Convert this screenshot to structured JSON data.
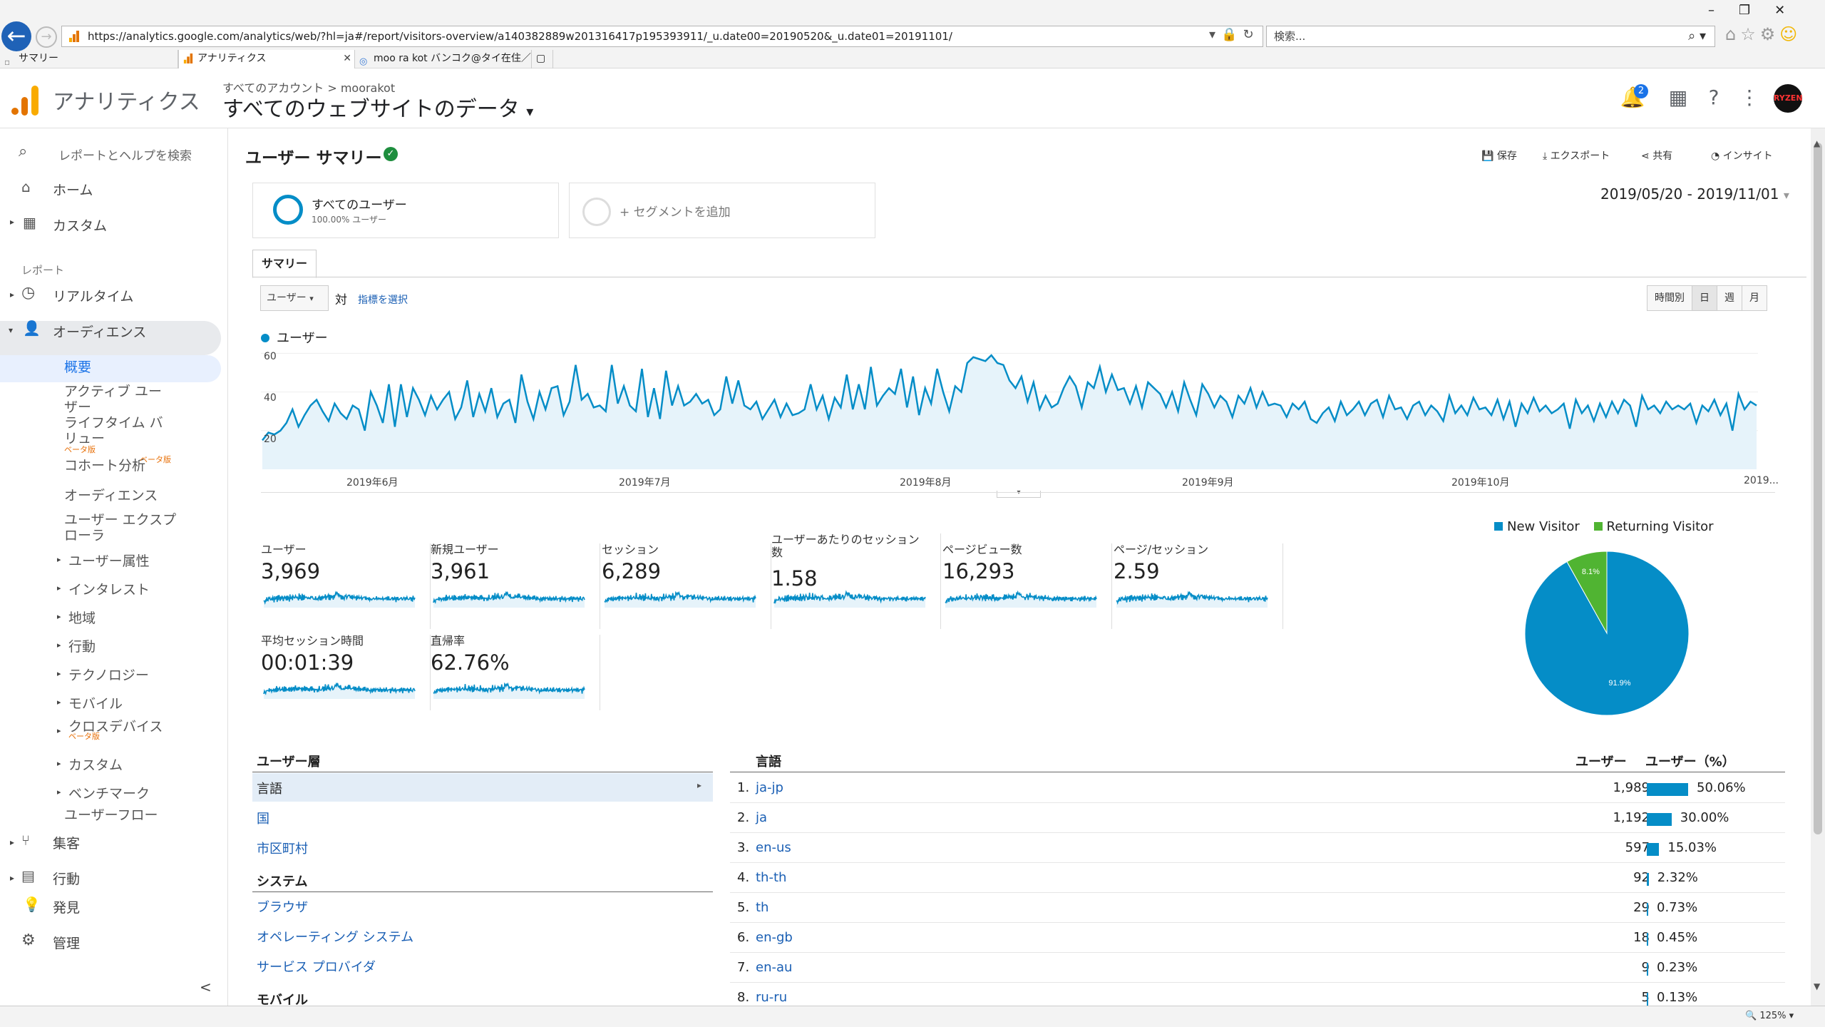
{
  "browser": {
    "url": "https://analytics.google.com/analytics/web/?hl=ja#/report/visitors-overview/a140382889w201316417p195393911/_u.date00=20190520&_u.date01=20191101/",
    "search_placeholder": "検索...",
    "tabs": [
      {
        "label": "サマリー"
      },
      {
        "label": "アナリティクス"
      },
      {
        "label": "moo ra kot バンコク@タイ在住／..."
      }
    ],
    "zoom": "125%"
  },
  "ga": {
    "product": "アナリティクス",
    "account_crumb": "すべてのアカウント > moorakot",
    "view_title": "すべてのウェブサイトのデータ",
    "notifications": "2",
    "avatar_text": "RYZEN"
  },
  "sidebar": {
    "search": "レポートとヘルプを検索",
    "home": "ホーム",
    "custom": "カスタム",
    "reports_header": "レポート",
    "realtime": "リアルタイム",
    "audience": "オーディエンス",
    "overview": "概要",
    "active_users": "アクティブ ユーザー",
    "lifetime_value": "ライフタイム バリュー",
    "cohort": "コホート分析",
    "beta": "ベータ版",
    "audiences": "オーディエンス",
    "user_explorer": "ユーザー エクスプローラ",
    "demographics": "ユーザー属性",
    "interests": "インタレスト",
    "geo": "地域",
    "behavior_sub": "行動",
    "technology": "テクノロジー",
    "mobile": "モバイル",
    "cross_device": "クロスデバイス",
    "custom_sub": "カスタム",
    "benchmarking": "ベンチマーク",
    "users_flow": "ユーザーフロー",
    "acquisition": "集客",
    "behavior": "行動",
    "discover": "発見",
    "admin": "管理",
    "collapse": "<"
  },
  "report": {
    "title": "ユーザー サマリー",
    "actions": {
      "save": "保存",
      "export": "エクスポート",
      "share": "共有",
      "insights": "インサイト"
    },
    "segment_name": "すべてのユーザー",
    "segment_sub": "100.00% ユーザー",
    "add_segment": "+ セグメントを追加",
    "date_range": "2019/05/20 - 2019/11/01",
    "tab_summary": "サマリー",
    "metric_select": "ユーザー",
    "vs": "対",
    "pick_metric": "指標を選択",
    "granularity": [
      "時間別",
      "日",
      "週",
      "月"
    ]
  },
  "chart_data": {
    "type": "area",
    "series": [
      {
        "name": "ユーザー",
        "color": "#058dc7"
      }
    ],
    "yticks": [
      "20",
      "40",
      "60"
    ],
    "ylim": [
      0,
      62
    ],
    "xticks": [
      "2019年6月",
      "2019年7月",
      "2019年8月",
      "2019年9月",
      "2019年10月",
      "2019..."
    ],
    "values": [
      15,
      19,
      18,
      20,
      24,
      31,
      22,
      28,
      33,
      36,
      30,
      25,
      34,
      29,
      26,
      33,
      31,
      20,
      40,
      33,
      24,
      44,
      22,
      44,
      27,
      42,
      36,
      28,
      38,
      31,
      36,
      40,
      26,
      32,
      46,
      27,
      39,
      30,
      42,
      27,
      34,
      36,
      24,
      49,
      35,
      26,
      40,
      31,
      42,
      43,
      28,
      35,
      54,
      36,
      39,
      32,
      33,
      30,
      54,
      34,
      43,
      33,
      30,
      52,
      27,
      42,
      26,
      51,
      33,
      43,
      33,
      35,
      39,
      34,
      36,
      28,
      31,
      48,
      34,
      46,
      33,
      31,
      35,
      26,
      31,
      36,
      27,
      34,
      28,
      29,
      31,
      44,
      31,
      38,
      26,
      37,
      32,
      49,
      31,
      44,
      31,
      53,
      33,
      38,
      42,
      39,
      52,
      32,
      48,
      28,
      42,
      34,
      52,
      40,
      30,
      43,
      40,
      55,
      58,
      57,
      56,
      59,
      55,
      54,
      46,
      42,
      48,
      35,
      45,
      31,
      38,
      32,
      34,
      42,
      48,
      43,
      32,
      45,
      42,
      53,
      40,
      49,
      41,
      42,
      34,
      43,
      32,
      45,
      42,
      39,
      32,
      40,
      30,
      45,
      36,
      28,
      44,
      39,
      32,
      38,
      35,
      27,
      38,
      34,
      42,
      32,
      40,
      33,
      34,
      33,
      27,
      34,
      31,
      35,
      26,
      24,
      29,
      32,
      25,
      35,
      28,
      31,
      35,
      28,
      34,
      36,
      27,
      38,
      31,
      32,
      26,
      33,
      35,
      28,
      33,
      30,
      25,
      38,
      29,
      33,
      28,
      37,
      31,
      32,
      28,
      36,
      26,
      35,
      22,
      34,
      29,
      37,
      30,
      33,
      29,
      31,
      34,
      21,
      36,
      29,
      33,
      25,
      34,
      27,
      35,
      29,
      36,
      33,
      22,
      38,
      31,
      33,
      29,
      35,
      31,
      33,
      31,
      34,
      24,
      33,
      30,
      36,
      28,
      34,
      20,
      39,
      31,
      35,
      33
    ]
  },
  "scorecards": [
    {
      "label": "ユーザー",
      "value": "3,969"
    },
    {
      "label": "新規ユーザー",
      "value": "3,961"
    },
    {
      "label": "セッション",
      "value": "6,289"
    },
    {
      "label": "ユーザーあたりのセッション数",
      "value": "1.58"
    },
    {
      "label": "ページビュー数",
      "value": "16,293"
    },
    {
      "label": "ページ/セッション",
      "value": "2.59"
    },
    {
      "label": "平均セッション時間",
      "value": "00:01:39"
    },
    {
      "label": "直帰率",
      "value": "62.76%"
    }
  ],
  "pie": {
    "legend": [
      {
        "name": "New Visitor",
        "color": "#058dc7"
      },
      {
        "name": "Returning Visitor",
        "color": "#50b432"
      }
    ],
    "values": [
      91.9,
      8.1
    ],
    "labels": [
      "91.9%",
      "8.1%"
    ]
  },
  "dimensions": {
    "group_user": "ユーザー層",
    "language": "言語",
    "country": "国",
    "city": "市区町村",
    "group_system": "システム",
    "browser": "ブラウザ",
    "os": "オペレーティング システム",
    "isp": "サービス プロバイダ",
    "group_mobile": "モバイル"
  },
  "language_table": {
    "header_dim": "言語",
    "header_users": "ユーザー",
    "header_pct": "ユーザー（%）",
    "rows": [
      {
        "rank": "1.",
        "lang": "ja-jp",
        "users": "1,989",
        "pct": "50.06%",
        "share": 50.06
      },
      {
        "rank": "2.",
        "lang": "ja",
        "users": "1,192",
        "pct": "30.00%",
        "share": 30.0
      },
      {
        "rank": "3.",
        "lang": "en-us",
        "users": "597",
        "pct": "15.03%",
        "share": 15.03
      },
      {
        "rank": "4.",
        "lang": "th-th",
        "users": "92",
        "pct": "2.32%",
        "share": 2.32
      },
      {
        "rank": "5.",
        "lang": "th",
        "users": "29",
        "pct": "0.73%",
        "share": 0.73
      },
      {
        "rank": "6.",
        "lang": "en-gb",
        "users": "18",
        "pct": "0.45%",
        "share": 0.45
      },
      {
        "rank": "7.",
        "lang": "en-au",
        "users": "9",
        "pct": "0.23%",
        "share": 0.23
      },
      {
        "rank": "8.",
        "lang": "ru-ru",
        "users": "5",
        "pct": "0.13%",
        "share": 0.13
      }
    ]
  }
}
